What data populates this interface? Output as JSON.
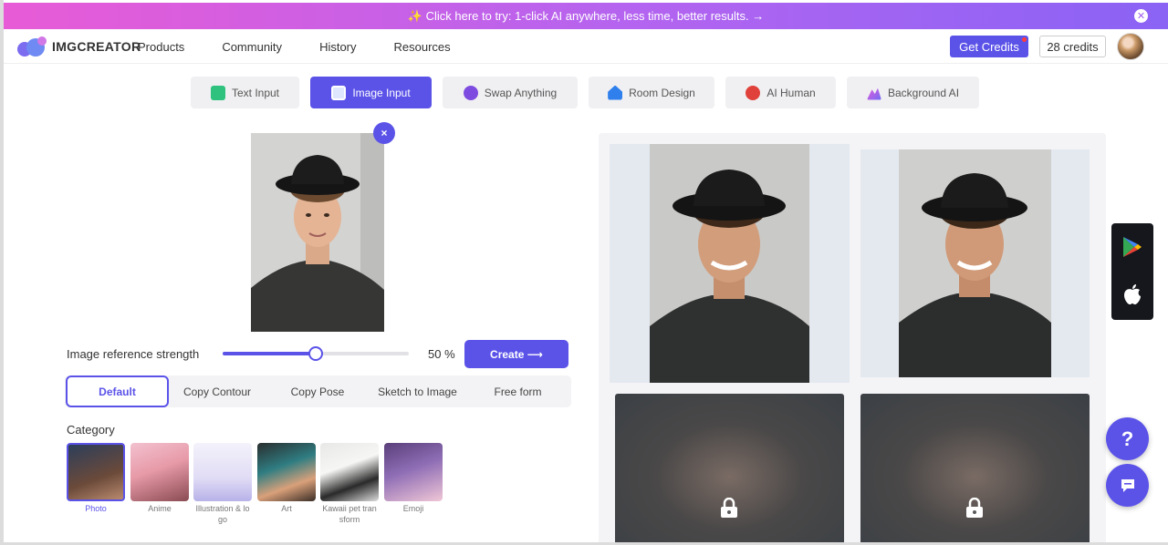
{
  "banner": {
    "text": "✨ Click here to try: 1-click AI anywhere, less time, better results. →",
    "close_icon": "close-icon"
  },
  "header": {
    "logo_text": "IMGCREATOR",
    "nav": [
      "Products",
      "Community",
      "History",
      "Resources"
    ],
    "get_credits_label": "Get Credits",
    "credits_label": "28 credits"
  },
  "tabs": [
    {
      "label": "Text Input",
      "icon": "text-input-icon",
      "active": false
    },
    {
      "label": "Image Input",
      "icon": "image-input-icon",
      "active": true
    },
    {
      "label": "Swap Anything",
      "icon": "swap-anything-icon",
      "active": false
    },
    {
      "label": "Room Design",
      "icon": "room-design-icon",
      "active": false
    },
    {
      "label": "AI Human",
      "icon": "ai-human-icon",
      "active": false
    },
    {
      "label": "Background AI",
      "icon": "background-ai-icon",
      "active": false
    }
  ],
  "editor": {
    "remove_icon": "×",
    "strength_label": "Image reference strength",
    "strength_value": 50,
    "strength_text": "50 %",
    "create_label": "Create ⟶"
  },
  "modes": [
    "Default",
    "Copy Contour",
    "Copy Pose",
    "Sketch to Image",
    "Free form"
  ],
  "category": {
    "label": "Category",
    "items": [
      "Photo",
      "Anime",
      "Illustration & logo",
      "Art",
      "Kawaii pet transform",
      "Emoji"
    ]
  },
  "help_label": "?",
  "colors": {
    "accent": "#5b53e8",
    "banner_start": "#e85bd6",
    "banner_end": "#8a63f5"
  }
}
